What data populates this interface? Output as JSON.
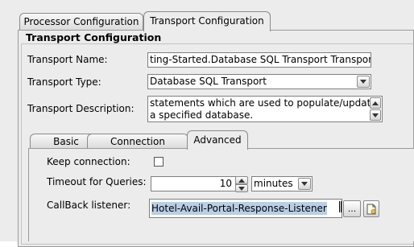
{
  "top_tabs": [
    "Processor Configuration",
    "Transport Configuration"
  ],
  "panel": {
    "title": "Transport Configuration",
    "transport_name_label": "Transport Name:",
    "transport_name_value": "ting-Started.Database SQL Transport Transport",
    "transport_type_label": "Transport Type:",
    "transport_type_value": "Database SQL Transport",
    "transport_description_label": "Transport Description:",
    "transport_description_lines": [
      "statements which are used to populate/update",
      "a specified database."
    ]
  },
  "sub_tabs": [
    "Basic",
    "Connection",
    "Advanced"
  ],
  "advanced": {
    "keep_connection_label": "Keep connection:",
    "keep_connection_checked": false,
    "timeout_label": "Timeout for Queries:",
    "timeout_value": "10",
    "timeout_unit": "minutes",
    "callback_label": "CallBack listener:",
    "callback_value": "Hotel-Avail-Portal-Response-Listener",
    "browse_button_label": "...",
    "selection_color": "#b8cfe5"
  },
  "icons": {
    "dropdown": "chevron-down-icon",
    "spinner_up": "chevron-up-icon",
    "spinner_down": "chevron-down-icon",
    "new_document": "new-document-icon"
  }
}
